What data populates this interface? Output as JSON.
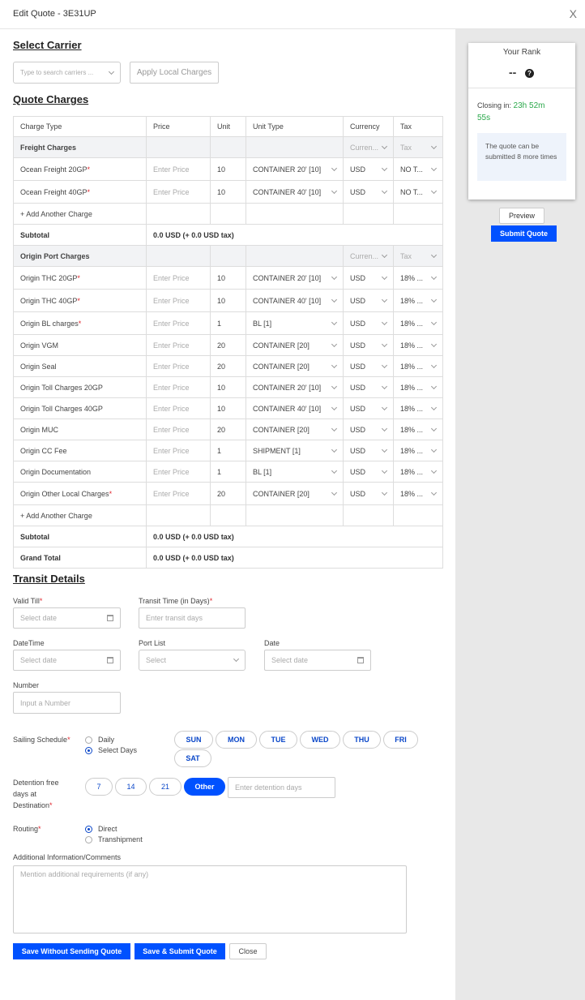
{
  "header": {
    "title": "Edit Quote - 3E31UP",
    "close": "X"
  },
  "carrier": {
    "section_title": "Select Carrier",
    "search_placeholder": "Type to search carriers ...",
    "apply_local_charges": "Apply Local Charges"
  },
  "quote_charges": {
    "section_title": "Quote Charges",
    "columns": [
      "Charge Type",
      "Price",
      "Unit",
      "Unit Type",
      "Currency",
      "Tax"
    ],
    "freight": {
      "group_label": "Freight Charges",
      "currency_placeholder": "Curren...",
      "tax_placeholder": "Tax",
      "rows": [
        {
          "name": "Ocean Freight 20GP",
          "required": "*",
          "price": "Enter Price",
          "unit": "10",
          "unit_type": "CONTAINER 20' [10]",
          "currency": "USD",
          "tax": "NO T..."
        },
        {
          "name": "Ocean Freight 40GP",
          "required": "*",
          "price": "Enter Price",
          "unit": "10",
          "unit_type": "CONTAINER 40' [10]",
          "currency": "USD",
          "tax": "NO T..."
        }
      ],
      "add_charge": "+ Add Another Charge",
      "subtotal_label": "Subtotal",
      "subtotal_value": "0.0 USD (+ 0.0 USD tax)"
    },
    "origin": {
      "group_label": "Origin Port Charges",
      "currency_placeholder": "Curren...",
      "tax_placeholder": "Tax",
      "rows": [
        {
          "name": "Origin THC 20GP",
          "required": "*",
          "price": "Enter Price",
          "unit": "10",
          "unit_type": "CONTAINER 20' [10]",
          "currency": "USD",
          "tax": "18% ..."
        },
        {
          "name": "Origin THC 40GP",
          "required": "*",
          "price": "Enter Price",
          "unit": "10",
          "unit_type": "CONTAINER 40' [10]",
          "currency": "USD",
          "tax": "18% ..."
        },
        {
          "name": "Origin BL charges",
          "required": "*",
          "price": "Enter Price",
          "unit": "1",
          "unit_type": "BL [1]",
          "currency": "USD",
          "tax": "18% ..."
        },
        {
          "name": "Origin VGM",
          "required": "",
          "price": "Enter Price",
          "unit": "20",
          "unit_type": "CONTAINER [20]",
          "currency": "USD",
          "tax": "18% ..."
        },
        {
          "name": "Origin Seal",
          "required": "",
          "price": "Enter Price",
          "unit": "20",
          "unit_type": "CONTAINER [20]",
          "currency": "USD",
          "tax": "18% ..."
        },
        {
          "name": "Origin Toll Charges 20GP",
          "required": "",
          "price": "Enter Price",
          "unit": "10",
          "unit_type": "CONTAINER 20' [10]",
          "currency": "USD",
          "tax": "18% ..."
        },
        {
          "name": "Origin Toll Charges 40GP",
          "required": "",
          "price": "Enter Price",
          "unit": "10",
          "unit_type": "CONTAINER 40' [10]",
          "currency": "USD",
          "tax": "18% ..."
        },
        {
          "name": "Origin MUC",
          "required": "",
          "price": "Enter Price",
          "unit": "20",
          "unit_type": "CONTAINER [20]",
          "currency": "USD",
          "tax": "18% ..."
        },
        {
          "name": "Origin CC Fee",
          "required": "",
          "price": "Enter Price",
          "unit": "1",
          "unit_type": "SHIPMENT [1]",
          "currency": "USD",
          "tax": "18% ..."
        },
        {
          "name": "Origin Documentation",
          "required": "",
          "price": "Enter Price",
          "unit": "1",
          "unit_type": "BL [1]",
          "currency": "USD",
          "tax": "18% ..."
        },
        {
          "name": "Origin Other Local Charges",
          "required": "*",
          "price": "Enter Price",
          "unit": "20",
          "unit_type": "CONTAINER [20]",
          "currency": "USD",
          "tax": "18% ..."
        }
      ],
      "add_charge": "+ Add Another Charge",
      "subtotal_label": "Subtotal",
      "subtotal_value": "0.0 USD (+ 0.0 USD tax)"
    },
    "grand_total_label": "Grand Total",
    "grand_total_value": "0.0 USD (+ 0.0 USD tax)"
  },
  "transit": {
    "section_title": "Transit Details",
    "valid_till_label": "Valid Till",
    "valid_till_placeholder": "Select date",
    "transit_time_label": "Transit Time (in Days)",
    "transit_time_placeholder": "Enter transit days",
    "datetime_label": "DateTime",
    "datetime_placeholder": "Select date",
    "port_list_label": "Port List",
    "port_list_placeholder": "Select",
    "date_label": "Date",
    "date_placeholder": "Select date",
    "number_label": "Number",
    "number_placeholder": "Input a Number",
    "required_mark": "*",
    "sailing_label": "Sailing Schedule",
    "sailing_options": [
      "Daily",
      "Select Days"
    ],
    "sailing_selected": "Select Days",
    "days": [
      "SUN",
      "MON",
      "TUE",
      "WED",
      "THU",
      "FRI",
      "SAT"
    ],
    "detention_label_lines": [
      "Detention free",
      "days at",
      "Destination"
    ],
    "detention_options": [
      "7",
      "14",
      "21",
      "Other"
    ],
    "detention_selected": "Other",
    "detention_placeholder": "Enter detention days",
    "routing_label": "Routing",
    "routing_options": [
      "Direct",
      "Transhipment"
    ],
    "routing_selected": "Direct",
    "comments_label": "Additional Information/Comments",
    "comments_placeholder": "Mention additional requirements (if any)"
  },
  "actions": {
    "save_without_sending": "Save Without Sending Quote",
    "save_submit": "Save & Submit Quote",
    "close": "Close"
  },
  "rank_panel": {
    "title": "Your Rank",
    "rank_value": "--",
    "help_icon": "question-circle-icon",
    "closing_label": "Closing in:",
    "closing_time_line1": "23h  52m",
    "closing_time_line2": "55s",
    "submit_note_pre": "The quote can be submitted ",
    "submit_note_count": "8",
    "submit_note_post": " more times",
    "preview": "Preview",
    "submit_quote": "Submit Quote"
  },
  "colors": {
    "accent": "#0051ff",
    "link": "#0a47c9",
    "required": "#e0282f",
    "timer": "#2aa84a",
    "side_bg": "#e8e8e8"
  }
}
